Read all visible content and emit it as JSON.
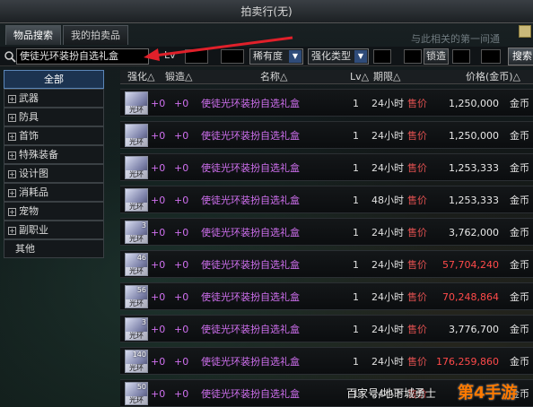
{
  "window": {
    "title": "拍卖行(无)"
  },
  "tabs": [
    {
      "label": "物品搜索",
      "active": true
    },
    {
      "label": "我的拍卖品",
      "active": false
    }
  ],
  "background_text": "与此相关的第一间通",
  "filter": {
    "search_value": "使徒光环装扮自选礼盒",
    "lv_label": "Lv",
    "rarity_label": "稀有度",
    "enhance_type_label": "强化类型",
    "sort_label": "锁造",
    "search_button": "搜索"
  },
  "categories": [
    {
      "label": "全部",
      "expandable": false,
      "active": true
    },
    {
      "label": "武器",
      "expandable": true
    },
    {
      "label": "防具",
      "expandable": true
    },
    {
      "label": "首饰",
      "expandable": true
    },
    {
      "label": "特殊装备",
      "expandable": true
    },
    {
      "label": "设计图",
      "expandable": true
    },
    {
      "label": "消耗品",
      "expandable": true
    },
    {
      "label": "宠物",
      "expandable": true
    },
    {
      "label": "副职业",
      "expandable": true
    },
    {
      "label": "其他",
      "expandable": false
    }
  ],
  "columns": {
    "enhance": "强化△",
    "forge": "锻造△",
    "name": "名称△",
    "lv": "Lv△",
    "period": "期限△",
    "price": "价格(金币)△"
  },
  "rows": [
    {
      "icon_label": "光环",
      "icon_level": "",
      "enhance": "+0",
      "forge": "+0",
      "name": "使徒光环装扮自选礼盒",
      "lv": "1",
      "period": "24小时",
      "sale": "售价",
      "price": "1,250,000",
      "price_color": "white",
      "currency": "金币"
    },
    {
      "icon_label": "光环",
      "icon_level": "",
      "enhance": "+0",
      "forge": "+0",
      "name": "使徒光环装扮自选礼盒",
      "lv": "1",
      "period": "24小时",
      "sale": "售价",
      "price": "1,250,000",
      "price_color": "white",
      "currency": "金币"
    },
    {
      "icon_label": "光环",
      "icon_level": "",
      "enhance": "+0",
      "forge": "+0",
      "name": "使徒光环装扮自选礼盒",
      "lv": "1",
      "period": "24小时",
      "sale": "售价",
      "price": "1,253,333",
      "price_color": "white",
      "currency": "金币"
    },
    {
      "icon_label": "光环",
      "icon_level": "",
      "enhance": "+0",
      "forge": "+0",
      "name": "使徒光环装扮自选礼盒",
      "lv": "1",
      "period": "48小时",
      "sale": "售价",
      "price": "1,253,333",
      "price_color": "white",
      "currency": "金币"
    },
    {
      "icon_label": "光环",
      "icon_level": "3",
      "enhance": "+0",
      "forge": "+0",
      "name": "使徒光环装扮自选礼盒",
      "lv": "1",
      "period": "24小时",
      "sale": "售价",
      "price": "3,762,000",
      "price_color": "white",
      "currency": "金币"
    },
    {
      "icon_label": "光环",
      "icon_level": "46",
      "enhance": "+0",
      "forge": "+0",
      "name": "使徒光环装扮自选礼盒",
      "lv": "1",
      "period": "24小时",
      "sale": "售价",
      "price": "57,704,240",
      "price_color": "red",
      "currency": "金币"
    },
    {
      "icon_label": "光环",
      "icon_level": "56",
      "enhance": "+0",
      "forge": "+0",
      "name": "使徒光环装扮自选礼盒",
      "lv": "1",
      "period": "24小时",
      "sale": "售价",
      "price": "70,248,864",
      "price_color": "red",
      "currency": "金币"
    },
    {
      "icon_label": "光环",
      "icon_level": "3",
      "enhance": "+0",
      "forge": "+0",
      "name": "使徒光环装扮自选礼盒",
      "lv": "1",
      "period": "24小时",
      "sale": "售价",
      "price": "3,776,700",
      "price_color": "white",
      "currency": "金币"
    },
    {
      "icon_label": "光环",
      "icon_level": "140",
      "enhance": "+0",
      "forge": "+0",
      "name": "使徒光环装扮自选礼盒",
      "lv": "1",
      "period": "24小时",
      "sale": "售价",
      "price": "176,259,860",
      "price_color": "red",
      "currency": "金币"
    },
    {
      "icon_label": "光环",
      "icon_level": "50",
      "enhance": "+0",
      "forge": "+0",
      "name": "使徒光环装扮自选礼盒",
      "lv": "1",
      "period": "24小时",
      "sale": "售价",
      "price": "",
      "price_color": "red",
      "currency": "金币"
    }
  ],
  "watermark": {
    "text": "百家号/地下城勇士",
    "logo": "第4手游"
  },
  "colors": {
    "item_name": "#d070f0",
    "sale_label": "#e05050",
    "price_high": "#ff4a4a",
    "active_category": "#1c3350",
    "logo": "#ff7a00"
  }
}
